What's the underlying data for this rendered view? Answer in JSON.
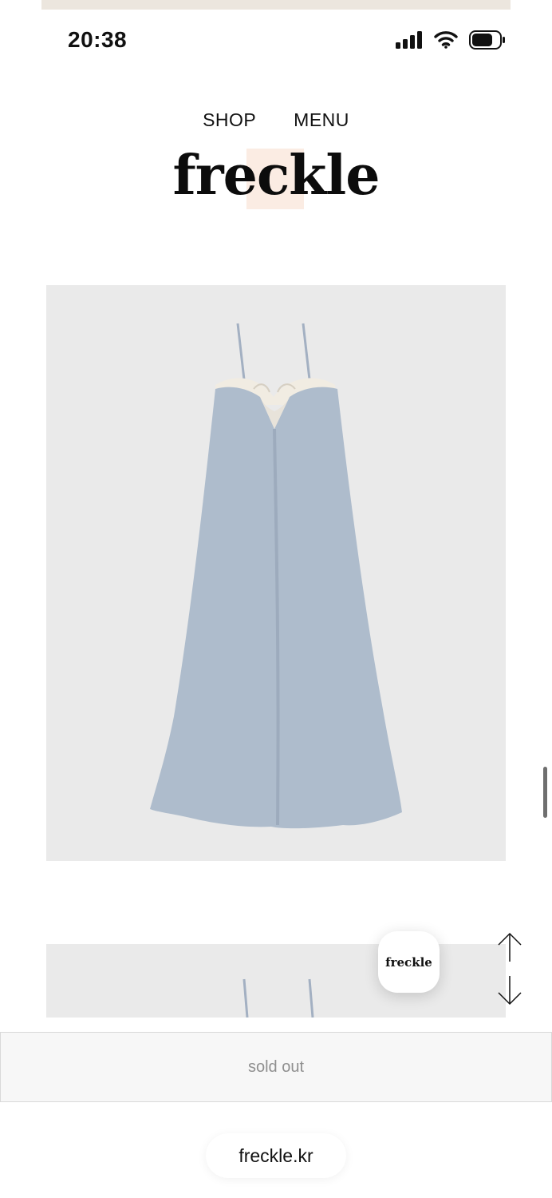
{
  "status_bar": {
    "time": "20:38"
  },
  "nav": {
    "shop": "SHOP",
    "menu": "MENU"
  },
  "brand": {
    "logo": "freckle"
  },
  "float_button": {
    "label": "freckle"
  },
  "buy": {
    "label": "sold out"
  },
  "browser": {
    "url": "freckle.kr"
  },
  "colors": {
    "logo_highlight": "#fbece3",
    "dress": "#aebccc",
    "image_bg": "#eaeaea"
  },
  "icons": [
    "signal-icon",
    "wifi-icon",
    "battery-icon",
    "arrow-up-icon",
    "arrow-down-icon"
  ]
}
